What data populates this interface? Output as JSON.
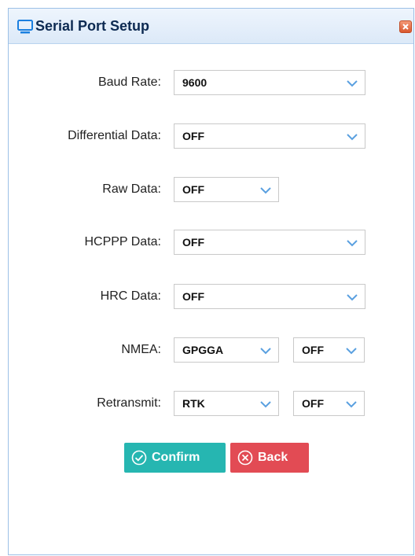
{
  "dialog": {
    "title": "Serial Port Setup",
    "icons": {
      "title": "monitor-icon",
      "close": "close-icon",
      "chevron": "chevron-down-icon"
    }
  },
  "fields": {
    "baud_rate": {
      "label": "Baud Rate:",
      "value": "9600"
    },
    "differential_data": {
      "label": "Differential Data:",
      "value": "OFF"
    },
    "raw_data": {
      "label": "Raw Data:",
      "value": "OFF"
    },
    "hcppp_data": {
      "label": "HCPPP Data:",
      "value": "OFF"
    },
    "hrc_data": {
      "label": "HRC Data:",
      "value": "OFF"
    },
    "nmea": {
      "label": "NMEA:",
      "value": "GPGGA",
      "state": "OFF"
    },
    "retransmit": {
      "label": "Retransmit:",
      "value": "RTK",
      "state": "OFF"
    }
  },
  "buttons": {
    "confirm_label": "Confirm",
    "back_label": "Back"
  },
  "colors": {
    "confirm": "#26b6b1",
    "back": "#e24b54",
    "title_text": "#0d2a52",
    "chevron": "#5aa0e0"
  }
}
